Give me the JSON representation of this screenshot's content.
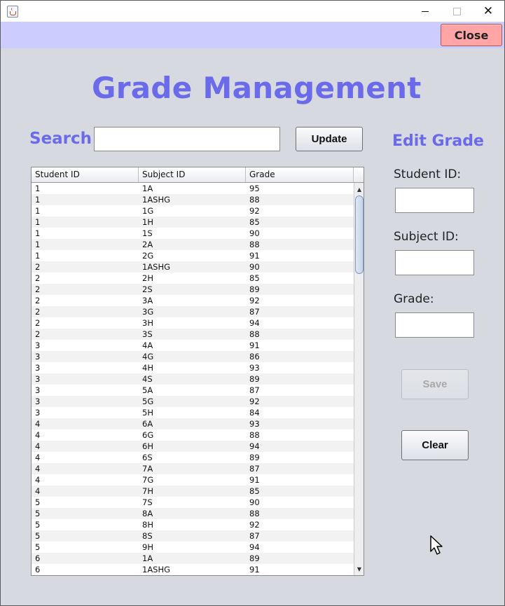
{
  "window": {
    "controls": {
      "minimize": "minimize",
      "maximize": "maximize",
      "close": "✕"
    }
  },
  "header": {
    "close_label": "Close"
  },
  "app_title": "Grade Management",
  "search": {
    "label": "Search",
    "value": "",
    "update_label": "Update"
  },
  "edit": {
    "title": "Edit Grade",
    "student_id_label": "Student ID:",
    "subject_id_label": "Subject ID:",
    "grade_label": "Grade:",
    "student_id_value": "",
    "subject_id_value": "",
    "grade_value": "",
    "save_label": "Save",
    "clear_label": "Clear"
  },
  "table": {
    "columns": [
      "Student ID",
      "Subject ID",
      "Grade"
    ],
    "rows": [
      [
        "1",
        "1A",
        "95"
      ],
      [
        "1",
        "1ASHG",
        "88"
      ],
      [
        "1",
        "1G",
        "92"
      ],
      [
        "1",
        "1H",
        "85"
      ],
      [
        "1",
        "1S",
        "90"
      ],
      [
        "1",
        "2A",
        "88"
      ],
      [
        "1",
        "2G",
        "91"
      ],
      [
        "2",
        "1ASHG",
        "90"
      ],
      [
        "2",
        "2H",
        "85"
      ],
      [
        "2",
        "2S",
        "89"
      ],
      [
        "2",
        "3A",
        "92"
      ],
      [
        "2",
        "3G",
        "87"
      ],
      [
        "2",
        "3H",
        "94"
      ],
      [
        "2",
        "3S",
        "88"
      ],
      [
        "3",
        "4A",
        "91"
      ],
      [
        "3",
        "4G",
        "86"
      ],
      [
        "3",
        "4H",
        "93"
      ],
      [
        "3",
        "4S",
        "89"
      ],
      [
        "3",
        "5A",
        "87"
      ],
      [
        "3",
        "5G",
        "92"
      ],
      [
        "3",
        "5H",
        "84"
      ],
      [
        "4",
        "6A",
        "93"
      ],
      [
        "4",
        "6G",
        "88"
      ],
      [
        "4",
        "6H",
        "94"
      ],
      [
        "4",
        "6S",
        "89"
      ],
      [
        "4",
        "7A",
        "87"
      ],
      [
        "4",
        "7G",
        "91"
      ],
      [
        "4",
        "7H",
        "85"
      ],
      [
        "5",
        "7S",
        "90"
      ],
      [
        "5",
        "8A",
        "88"
      ],
      [
        "5",
        "8H",
        "92"
      ],
      [
        "5",
        "8S",
        "87"
      ],
      [
        "5",
        "9H",
        "94"
      ],
      [
        "6",
        "1A",
        "89"
      ],
      [
        "6",
        "1ASHG",
        "91"
      ]
    ]
  },
  "icons": {
    "app": "java-cup-icon",
    "scroll_up": "scroll-up-arrow-icon",
    "scroll_down": "scroll-down-arrow-icon",
    "cursor": "mouse-pointer-icon"
  },
  "colors": {
    "title": "#6a6aea",
    "top_band": "#ccccff",
    "close_button": "#ffa5a5",
    "background": "#d6d9e0"
  }
}
